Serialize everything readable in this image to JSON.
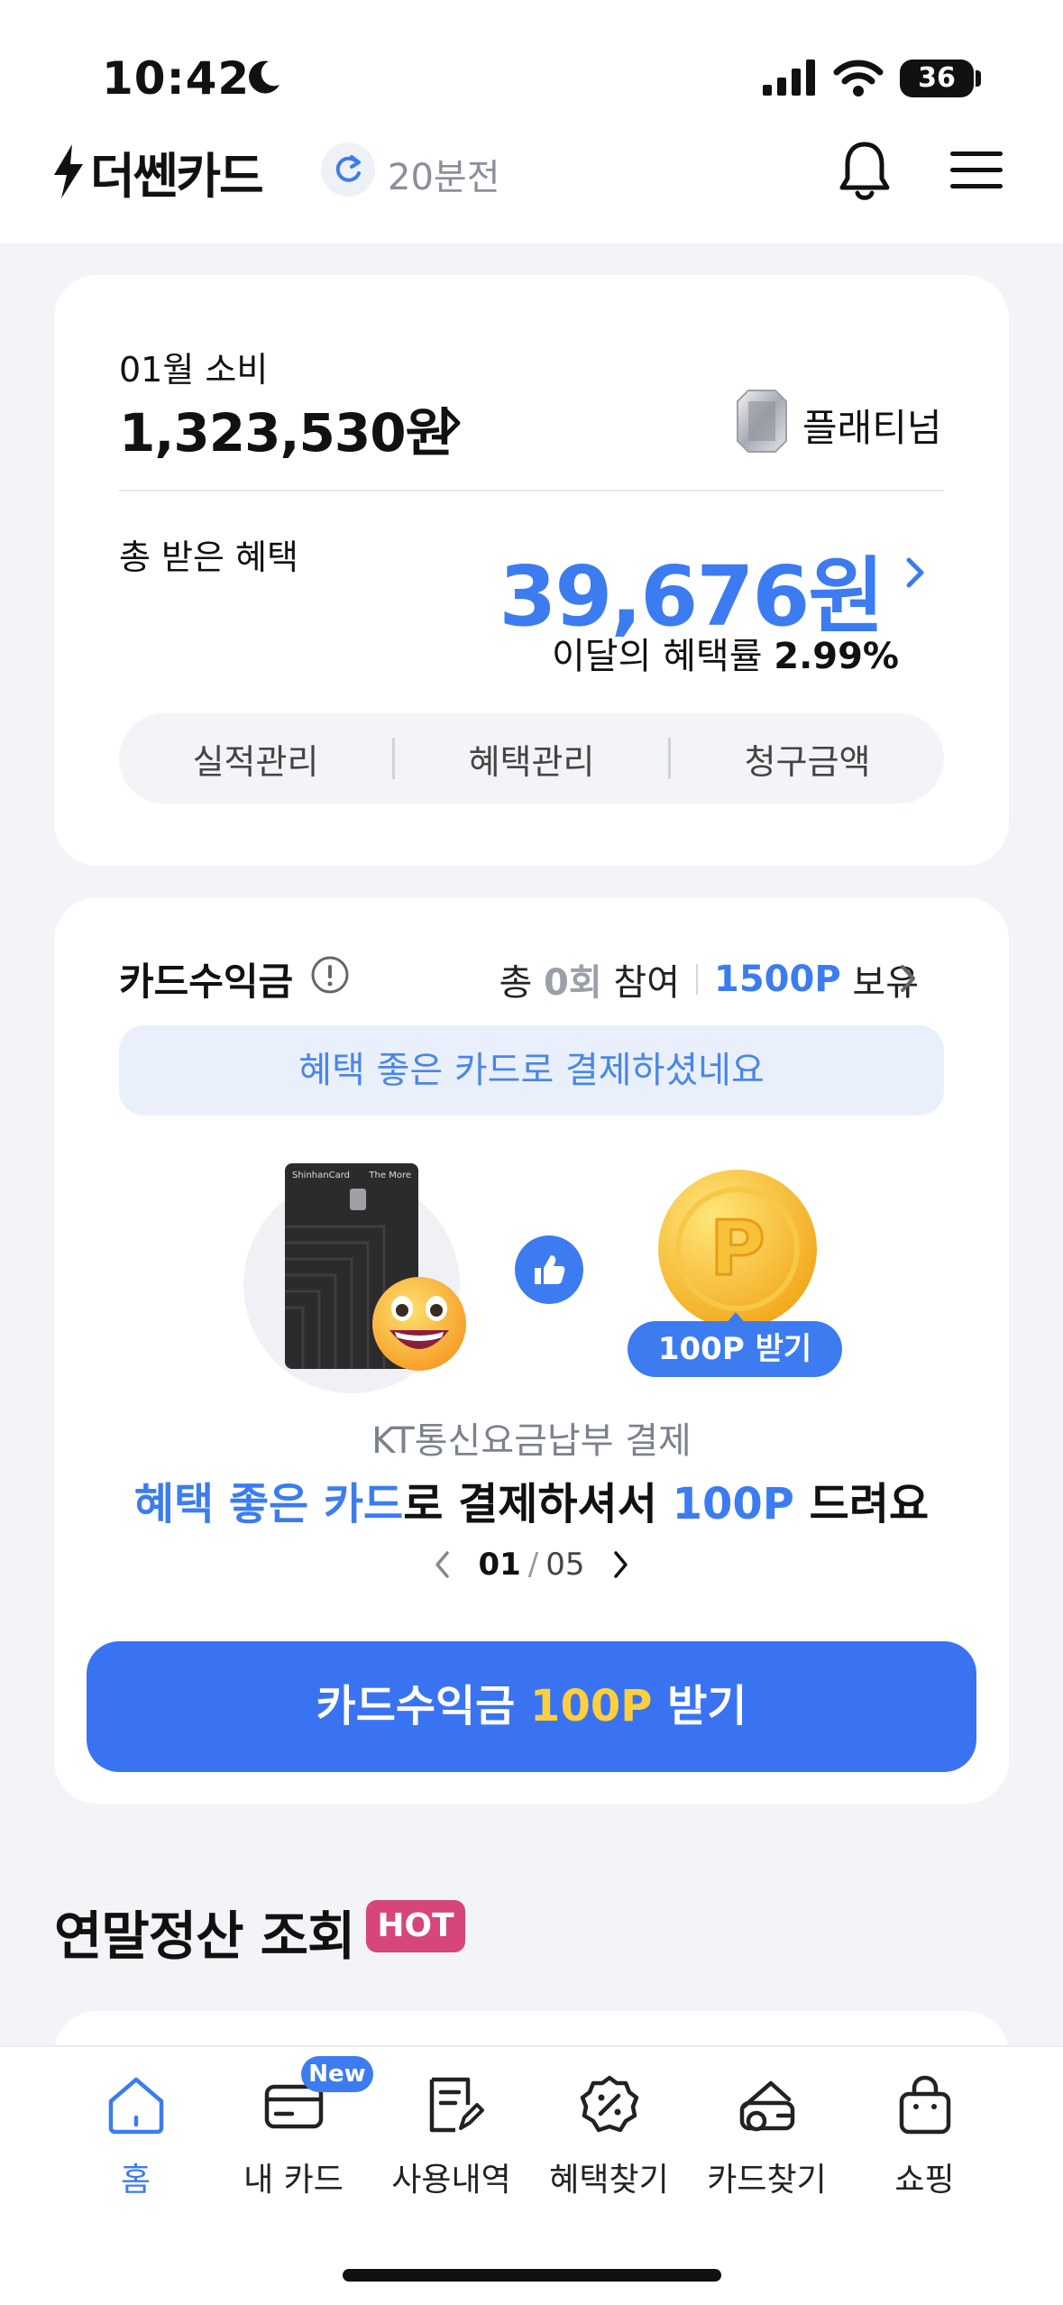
{
  "status_bar": {
    "time": "10:42",
    "battery": "36"
  },
  "header": {
    "logo": "더쎈카드",
    "refresh_time": "20분전"
  },
  "spend_card": {
    "month_label": "01월 소비",
    "month_amount": "1,323,530원",
    "tier": "플래티넘",
    "benefit_label": "총 받은 혜택",
    "benefit_amount": "39,676원",
    "benefit_rate_label": "이달의 혜택률",
    "benefit_rate_value": "2.99%",
    "segments": [
      "실적관리",
      "혜택관리",
      "청구금액"
    ]
  },
  "reward_card": {
    "title": "카드수익금",
    "stats_prefix": "총",
    "participation_count": "0회",
    "participation_suffix": "참여",
    "points_held": "1500P",
    "points_suffix": "보유",
    "banner": "혜택 좋은 카드로 결제하셨네요",
    "card_brand": "ShinhanCard",
    "card_name": "The More",
    "coin_pill": "100P 받기",
    "subtitle": "KT통신요금납부 결제",
    "main_part1": "혜택 좋은 카드",
    "main_part2": "로 결제하셔서 ",
    "main_part3": "100P",
    "main_part4": " 드려요",
    "pager_current": "01",
    "pager_total": "05",
    "cta_part1": "카드수익금 ",
    "cta_part2": "100P",
    "cta_part3": " 받기"
  },
  "section": {
    "title": "연말정산 조회",
    "badge": "HOT"
  },
  "tabbar": {
    "items": [
      {
        "label": "홈",
        "icon": "home-icon",
        "active": true
      },
      {
        "label": "내 카드",
        "icon": "card-icon",
        "badge": "New"
      },
      {
        "label": "사용내역",
        "icon": "receipt-icon"
      },
      {
        "label": "혜택찾기",
        "icon": "discount-icon"
      },
      {
        "label": "카드찾기",
        "icon": "card-search-icon"
      },
      {
        "label": "쇼핑",
        "icon": "shopping-bag-icon"
      }
    ]
  },
  "colors": {
    "accent": "#3c7cf0",
    "cta": "#3a73f2",
    "hot": "#d6457c",
    "coin": "#f4c531",
    "points_highlight": "#ffcf3d"
  }
}
